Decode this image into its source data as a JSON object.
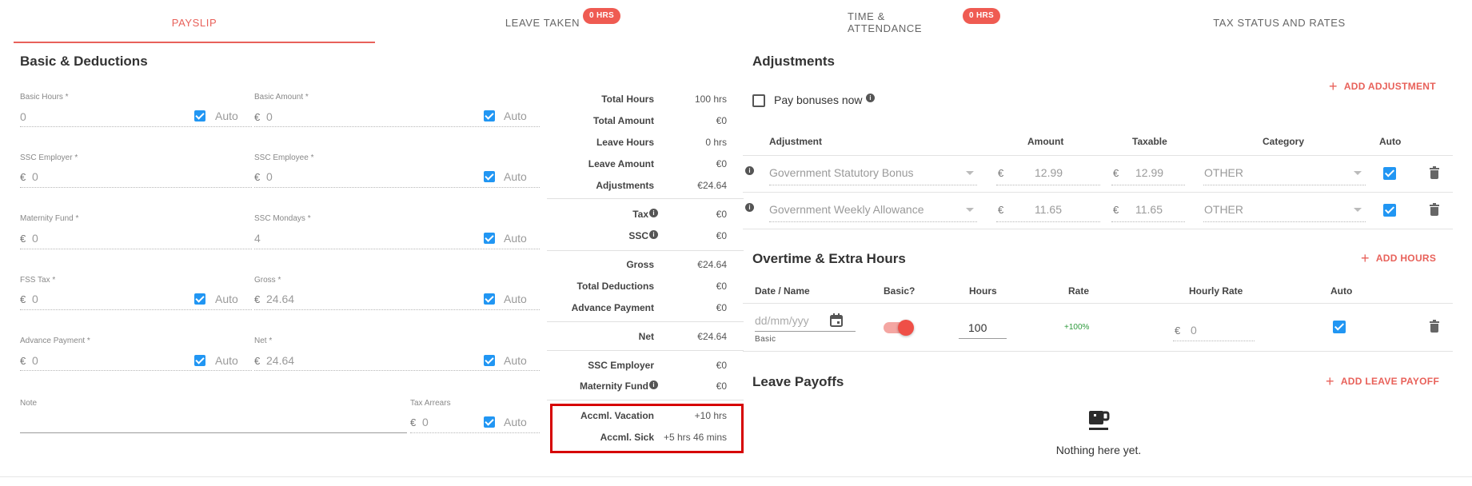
{
  "tabs": [
    {
      "label": "PAYSLIP"
    },
    {
      "label": "LEAVE TAKEN",
      "badge": "0 HRS"
    },
    {
      "label": "TIME & ATTENDANCE",
      "badge": "0 HRS"
    },
    {
      "label": "TAX STATUS AND RATES"
    }
  ],
  "basic": {
    "title": "Basic & Deductions",
    "currency": "€",
    "auto_label": "Auto",
    "fields": {
      "basic_hours": {
        "label": "Basic Hours *",
        "value": "0"
      },
      "basic_amount": {
        "label": "Basic Amount *",
        "value": "0"
      },
      "ssc_employer": {
        "label": "SSC Employer *",
        "value": "0"
      },
      "ssc_employee": {
        "label": "SSC Employee *",
        "value": "0"
      },
      "maternity_fund": {
        "label": "Maternity Fund *",
        "value": "0"
      },
      "ssc_mondays": {
        "label": "SSC Mondays *",
        "value": "4"
      },
      "fss_tax": {
        "label": "FSS Tax *",
        "value": "0"
      },
      "gross": {
        "label": "Gross *",
        "value": "24.64"
      },
      "advance_payment": {
        "label": "Advance Payment *",
        "value": "0"
      },
      "net": {
        "label": "Net *",
        "value": "24.64"
      },
      "note": {
        "label": "Note",
        "value": ""
      },
      "tax_arrears": {
        "label": "Tax Arrears",
        "value": "0"
      }
    }
  },
  "summary": {
    "total_hours": {
      "label": "Total Hours",
      "value": "100 hrs"
    },
    "total_amount": {
      "label": "Total Amount",
      "value": "€0"
    },
    "leave_hours": {
      "label": "Leave Hours",
      "value": "0 hrs"
    },
    "leave_amount": {
      "label": "Leave Amount",
      "value": "€0"
    },
    "adjustments": {
      "label": "Adjustments",
      "value": "€24.64"
    },
    "tax": {
      "label": "Tax",
      "value": "€0"
    },
    "ssc": {
      "label": "SSC",
      "value": "€0"
    },
    "gross": {
      "label": "Gross",
      "value": "€24.64"
    },
    "total_deductions": {
      "label": "Total Deductions",
      "value": "€0"
    },
    "advance_payment": {
      "label": "Advance Payment",
      "value": "€0"
    },
    "net": {
      "label": "Net",
      "value": "€24.64"
    },
    "ssc_employer": {
      "label": "SSC Employer",
      "value": "€0"
    },
    "maternity_fund": {
      "label": "Maternity Fund",
      "value": "€0"
    },
    "accml_vacation": {
      "label": "Accml. Vacation",
      "value": "+10 hrs"
    },
    "accml_sick": {
      "label": "Accml. Sick",
      "value": "+5 hrs 46 mins"
    }
  },
  "adjustments": {
    "title": "Adjustments",
    "add_label": "ADD ADJUSTMENT",
    "pay_bonuses_label": "Pay bonuses now",
    "columns": {
      "adjustment": "Adjustment",
      "amount": "Amount",
      "taxable": "Taxable",
      "category": "Category",
      "auto": "Auto"
    },
    "currency": "€",
    "rows": [
      {
        "adjustment": "Government Statutory Bonus",
        "amount": "12.99",
        "taxable": "12.99",
        "category": "OTHER"
      },
      {
        "adjustment": "Government Weekly Allowance",
        "amount": "11.65",
        "taxable": "11.65",
        "category": "OTHER"
      }
    ]
  },
  "overtime": {
    "title": "Overtime & Extra Hours",
    "add_label": "ADD HOURS",
    "columns": {
      "date_name": "Date / Name",
      "basic": "Basic?",
      "hours": "Hours",
      "rate": "Rate",
      "hourly_rate": "Hourly Rate",
      "auto": "Auto"
    },
    "row": {
      "date_placeholder": "dd/mm/yyy",
      "name": "Basic",
      "hours": "100",
      "rate": "+100%",
      "currency": "€",
      "hourly_rate": "0"
    }
  },
  "leave_payoffs": {
    "title": "Leave Payoffs",
    "add_label": "ADD LEAVE PAYOFF",
    "empty_text": "Nothing here yet."
  },
  "colors": {
    "accent": "#e8615a",
    "checkbox": "#2196f3",
    "highlight": "#d60000"
  }
}
